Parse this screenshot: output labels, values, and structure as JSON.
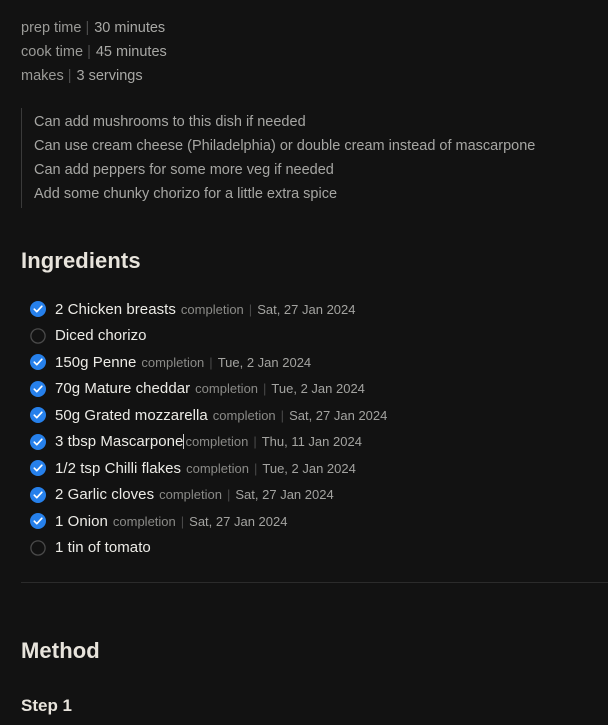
{
  "meta": {
    "separator": "|",
    "rows": [
      {
        "key": "prep time",
        "value": "30 minutes"
      },
      {
        "key": "cook time",
        "value": "45 minutes"
      },
      {
        "key": "makes",
        "value": "3 servings"
      }
    ]
  },
  "notes": [
    "Can add mushrooms to this dish if needed",
    "Can use cream cheese (Philadelphia) or double cream instead of mascarpone",
    "Can add peppers for some more veg if needed",
    "Add some chunky chorizo for a little extra spice"
  ],
  "headings": {
    "ingredients": "Ingredients",
    "method": "Method",
    "step": "Step 1"
  },
  "colors": {
    "background": "#121212",
    "checked_accent": "#2680eb",
    "unchecked_outline": "#4a4a4a",
    "divider": "#2b2b2b",
    "quote_bar": "#3a3a3a"
  },
  "icons": {
    "checked": "check-circle-filled-icon",
    "unchecked": "circle-outline-icon"
  },
  "ingredients": {
    "completion_label": "completion",
    "separator": "|",
    "items": [
      {
        "name": "2 Chicken breasts",
        "checked": true,
        "completion": "completion",
        "date": "Sat, 27 Jan 2024",
        "cursor": false
      },
      {
        "name": "Diced chorizo",
        "checked": false,
        "completion": "",
        "date": "",
        "cursor": false
      },
      {
        "name": "150g Penne",
        "checked": true,
        "completion": "completion",
        "date": "Tue, 2 Jan 2024",
        "cursor": false
      },
      {
        "name": "70g Mature cheddar",
        "checked": true,
        "completion": "completion",
        "date": "Tue, 2 Jan 2024",
        "cursor": false
      },
      {
        "name": "50g Grated mozzarella",
        "checked": true,
        "completion": "completion",
        "date": "Sat, 27 Jan 2024",
        "cursor": false
      },
      {
        "name": "3 tbsp Mascarpone",
        "checked": true,
        "completion": "completion",
        "date": "Thu, 11 Jan 2024",
        "cursor": true
      },
      {
        "name": "1/2 tsp Chilli flakes",
        "checked": true,
        "completion": "completion",
        "date": "Tue, 2 Jan 2024",
        "cursor": false
      },
      {
        "name": "2 Garlic cloves",
        "checked": true,
        "completion": "completion",
        "date": "Sat, 27 Jan 2024",
        "cursor": false
      },
      {
        "name": "1 Onion",
        "checked": true,
        "completion": "completion",
        "date": "Sat, 27 Jan 2024",
        "cursor": false
      },
      {
        "name": "1 tin of tomato",
        "checked": false,
        "completion": "",
        "date": "",
        "cursor": false
      }
    ]
  }
}
